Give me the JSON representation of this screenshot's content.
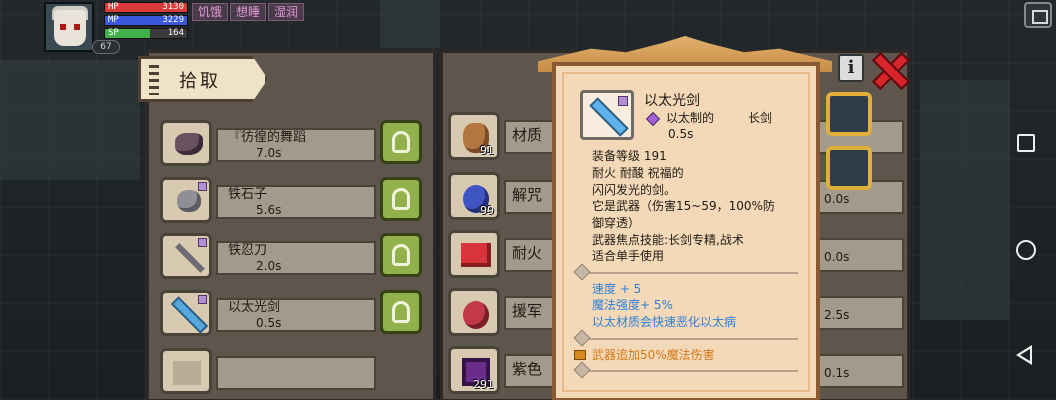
{
  "hud": {
    "hp": {
      "label": "HP",
      "value": "3130",
      "fill": 1.0,
      "color": "#d93a3a"
    },
    "mp": {
      "label": "MP",
      "value": "3229",
      "fill": 1.0,
      "color": "#3a58d9"
    },
    "sp": {
      "label": "SP",
      "value": "164",
      "fill": 0.55,
      "color": "#3fb04a"
    },
    "level": "67",
    "status_tags": [
      "饥饿",
      "想睡",
      "湿润"
    ]
  },
  "pickup_panel": {
    "title": "拾取",
    "items": [
      {
        "name": "『彷徨的舞蹈",
        "time": "7.0s",
        "icon": "dance-book-icon"
      },
      {
        "name": "铁石子",
        "time": "5.6s",
        "icon": "iron-stone-icon"
      },
      {
        "name": "铁忍刀",
        "time": "2.0s",
        "icon": "iron-ninja-blade-icon"
      },
      {
        "name": "以太光剑",
        "time": "0.5s",
        "icon": "ether-light-sword-icon"
      },
      {
        "name": "",
        "time": "",
        "icon": "empty-slot-icon"
      }
    ]
  },
  "middle_panel": {
    "items": [
      {
        "name": "材质",
        "count": "91",
        "time": "",
        "icon": "material-bag-icon"
      },
      {
        "name": "解咒",
        "count": "99",
        "time": "0.0s",
        "icon": "dispel-potion-icon"
      },
      {
        "name": "耐火",
        "count": "",
        "time": "0.0s",
        "icon": "fireproof-scroll-icon"
      },
      {
        "name": "援军",
        "count": "",
        "time": "2.5s",
        "icon": "reinforcement-flask-icon"
      },
      {
        "name": "紫色",
        "count": "291",
        "time": "0.1s",
        "icon": "purple-gem-icon"
      }
    ]
  },
  "tooltip": {
    "name": "以太光剑",
    "material": "以太制的",
    "type": "长剑",
    "duration": "0.5s",
    "desc_lines": [
      "装备等级 191",
      "耐火 耐酸 祝福的",
      "闪闪发光的剑。",
      "它是武器（伤害15~59，100%防",
      "御穿透）",
      "武器焦点技能:长剑专精,战术",
      "适合单手使用"
    ],
    "bonus_lines": [
      "速度 + 5",
      "魔法强度+ 5%",
      "以太材质会快速恶化以太病"
    ],
    "enchant": "武器追加50%魔法伤害",
    "info_label": "i"
  },
  "colors": {
    "panel": "#5e564d",
    "tooltip_bg": "#f3d9b8",
    "bonus_text": "#2e7fd4",
    "enchant_text": "#d37a1b",
    "pick_button": "#92b14c",
    "close": "#d8242b"
  }
}
